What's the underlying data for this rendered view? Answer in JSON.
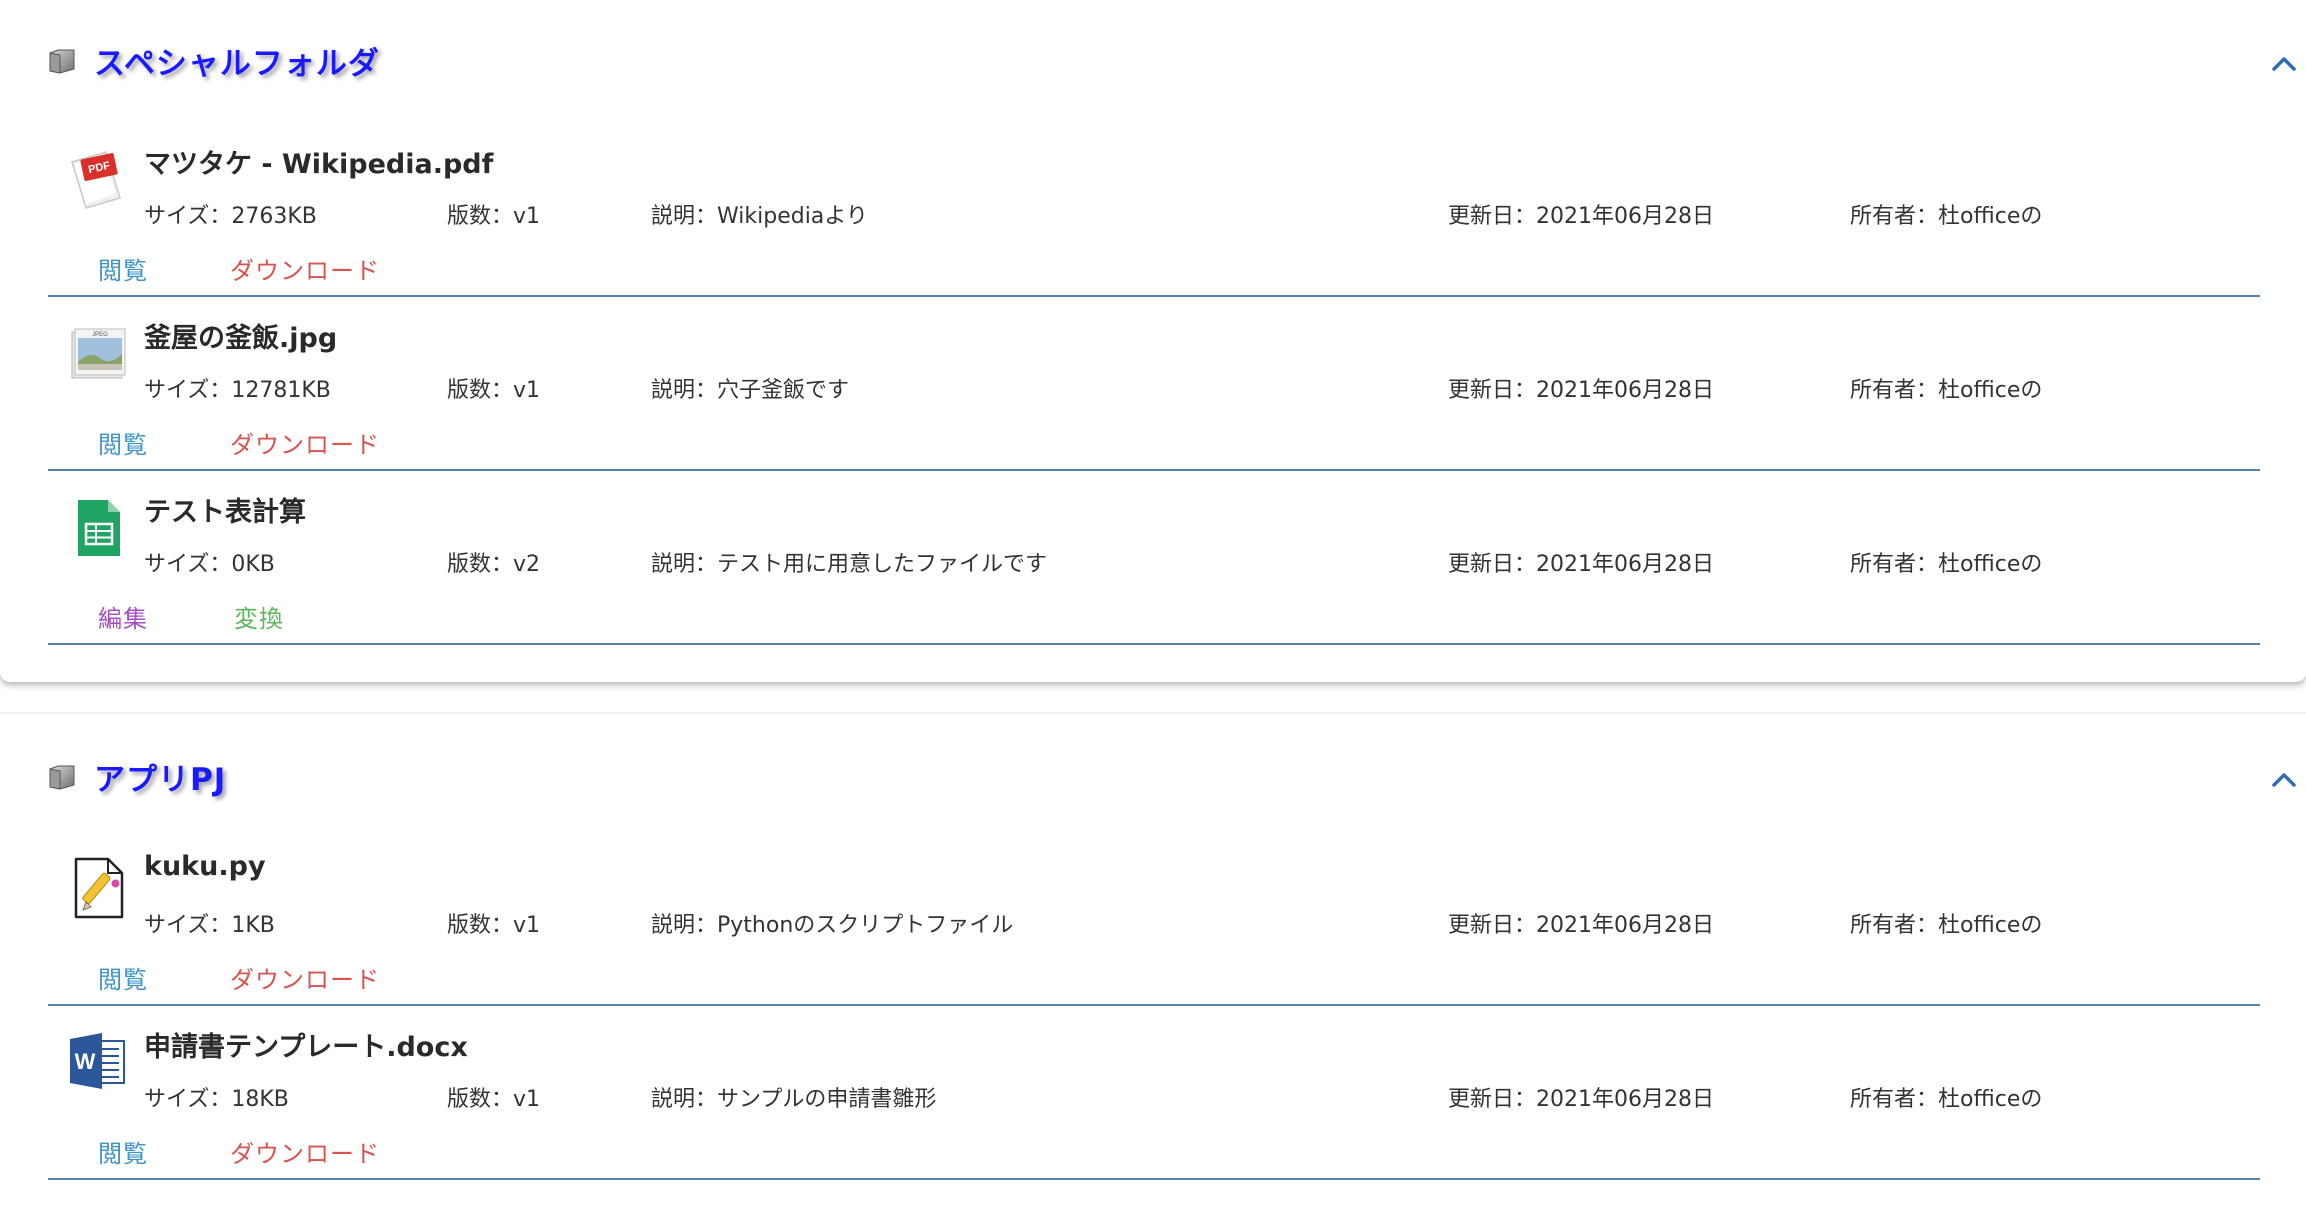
{
  "colors": {
    "folder_title": "#1a1aff",
    "divider": "#5a82a8",
    "collapse_chevron": "#2f6eb5",
    "action_view": "#3d95c9",
    "action_download": "#d9534f",
    "action_edit": "#a64dbf",
    "action_convert": "#5cb85c"
  },
  "folders": [
    {
      "title": "スペシャルフォルダ",
      "icon": "folder-icon",
      "collapse_icon": "chevron-up-icon",
      "files": [
        {
          "name": "マツタケ - Wikipedia.pdf",
          "icon": "pdf-file-icon",
          "size": "サイズ：2763KB",
          "version": "版数：v1",
          "description": "説明：Wikipediaより",
          "updated": "更新日：2021年06月28日",
          "owner": "所有者：杜officeの",
          "actions": [
            {
              "label": "閲覧",
              "kind": "view"
            },
            {
              "label": "ダウンロード",
              "kind": "download"
            }
          ]
        },
        {
          "name": "釜屋の釜飯.jpg",
          "icon": "jpeg-image-icon",
          "icon_text": "JPEG",
          "size": "サイズ：12781KB",
          "version": "版数：v1",
          "description": "説明：穴子釜飯です",
          "updated": "更新日：2021年06月28日",
          "owner": "所有者：杜officeの",
          "actions": [
            {
              "label": "閲覧",
              "kind": "view"
            },
            {
              "label": "ダウンロード",
              "kind": "download"
            }
          ]
        },
        {
          "name": "テスト表計算",
          "icon": "spreadsheet-icon",
          "size": "サイズ：0KB",
          "version": "版数：v2",
          "description": "説明：テスト用に用意したファイルです",
          "updated": "更新日：2021年06月28日",
          "owner": "所有者：杜officeの",
          "actions": [
            {
              "label": "編集",
              "kind": "edit"
            },
            {
              "label": "変換",
              "kind": "convert"
            }
          ]
        }
      ]
    },
    {
      "title": "アプリPJ",
      "icon": "folder-icon",
      "collapse_icon": "chevron-up-icon",
      "files": [
        {
          "name": "kuku.py",
          "icon": "text-edit-file-icon",
          "size": "サイズ：1KB",
          "version": "版数：v1",
          "description": "説明：Pythonのスクリプトファイル",
          "updated": "更新日：2021年06月28日",
          "owner": "所有者：杜officeの",
          "actions": [
            {
              "label": "閲覧",
              "kind": "view"
            },
            {
              "label": "ダウンロード",
              "kind": "download"
            }
          ]
        },
        {
          "name": "申請書テンプレート.docx",
          "icon": "word-document-icon",
          "icon_text": "W",
          "size": "サイズ：18KB",
          "version": "版数：v1",
          "description": "説明：サンプルの申請書雛形",
          "updated": "更新日：2021年06月28日",
          "owner": "所有者：杜officeの",
          "actions": [
            {
              "label": "閲覧",
              "kind": "view"
            },
            {
              "label": "ダウンロード",
              "kind": "download"
            }
          ]
        }
      ]
    }
  ]
}
